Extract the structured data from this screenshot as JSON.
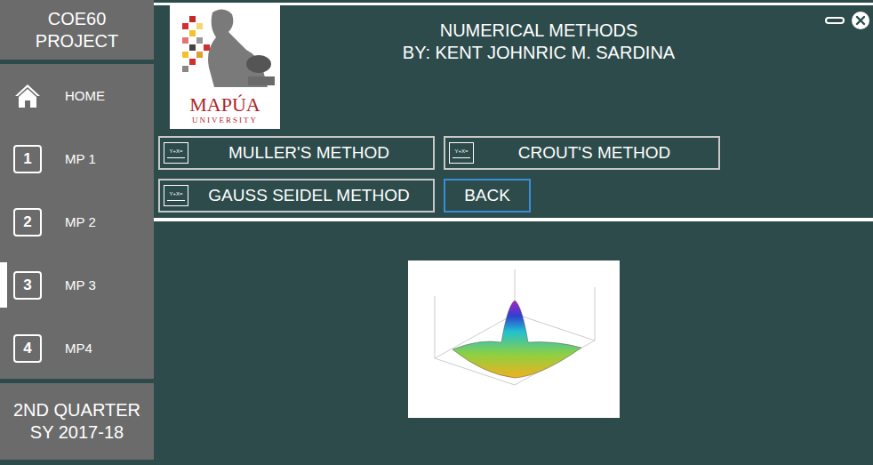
{
  "sidebar": {
    "title_lines": [
      "COE60",
      "PROJECT"
    ],
    "items": [
      {
        "label": "HOME",
        "kind": "home",
        "badge": "",
        "selected": false
      },
      {
        "label": "MP 1",
        "kind": "number",
        "badge": "1",
        "selected": false
      },
      {
        "label": "MP 2",
        "kind": "number",
        "badge": "2",
        "selected": false
      },
      {
        "label": "MP 3",
        "kind": "number",
        "badge": "3",
        "selected": true
      },
      {
        "label": "MP4",
        "kind": "number",
        "badge": "4",
        "selected": false
      }
    ],
    "footer_lines": [
      "2ND QUARTER",
      "SY 2017-18"
    ]
  },
  "header": {
    "logo_text": "MAPÚA",
    "logo_subtext": "UNIVERSITY",
    "title": "NUMERICAL METHODS",
    "subtitle": "BY: KENT JOHNRIC M. SARDINA"
  },
  "methods": [
    {
      "label": "MULLER'S METHOD",
      "kind": "method",
      "icon_text": "Y+X=",
      "focused": false
    },
    {
      "label": "CROUT'S METHOD",
      "kind": "method",
      "icon_text": "Y+X=",
      "focused": false
    },
    {
      "label": "GAUSS SEIDEL METHOD",
      "kind": "method",
      "icon_text": "Y+X=",
      "focused": false
    },
    {
      "label": "BACK",
      "kind": "back",
      "icon_text": "",
      "focused": true
    }
  ]
}
